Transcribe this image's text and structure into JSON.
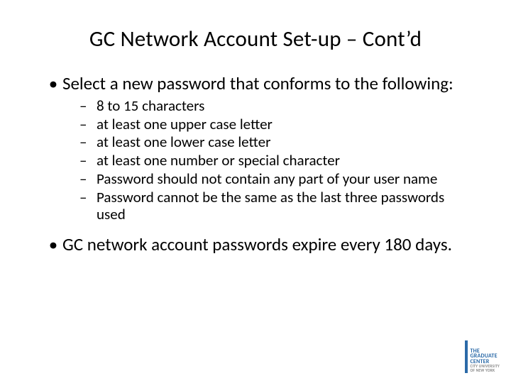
{
  "title": "GC Network Account Set-up – Cont’d",
  "bullets": [
    {
      "text": "Select a new password that conforms to the following:",
      "subitems": [
        "8 to 15 characters",
        "at least one upper case letter",
        "at least one lower case letter",
        "at least one number or special character",
        "Password should not contain any part of your user name",
        "Password cannot be the same as the last three passwords used"
      ]
    },
    {
      "text": "GC network account passwords expire every 180 days.",
      "subitems": []
    }
  ],
  "logo": {
    "line1a": "THE",
    "line1b": "GRADUATE",
    "line1c": "CENTER",
    "line2a": "CITY UNIVERSITY",
    "line2b": "OF NEW YORK"
  }
}
